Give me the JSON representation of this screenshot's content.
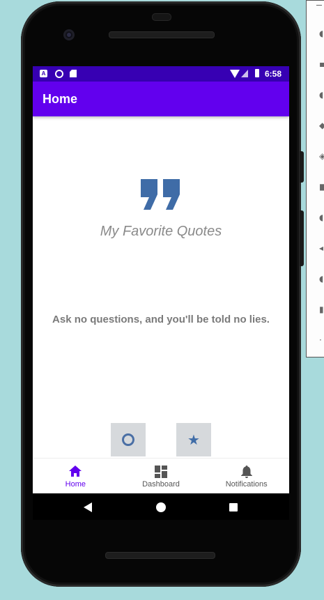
{
  "status_bar": {
    "time": "6:58"
  },
  "app_bar": {
    "title": "Home"
  },
  "content": {
    "subtitle": "My Favorite Quotes",
    "quote": "Ask no questions, and you'll be told no lies."
  },
  "actions": {
    "left_icon": "circle-icon",
    "right_icon": "star-icon"
  },
  "bottom_nav": {
    "items": [
      {
        "label": "Home",
        "icon": "home-icon",
        "active": true
      },
      {
        "label": "Dashboard",
        "icon": "dashboard-icon",
        "active": false
      },
      {
        "label": "Notifications",
        "icon": "bell-icon",
        "active": false
      }
    ]
  },
  "colors": {
    "primary": "#6200ee",
    "primary_dark": "#3700b3",
    "accent_icon": "#3f6ca7",
    "background": "#a8dadc"
  }
}
